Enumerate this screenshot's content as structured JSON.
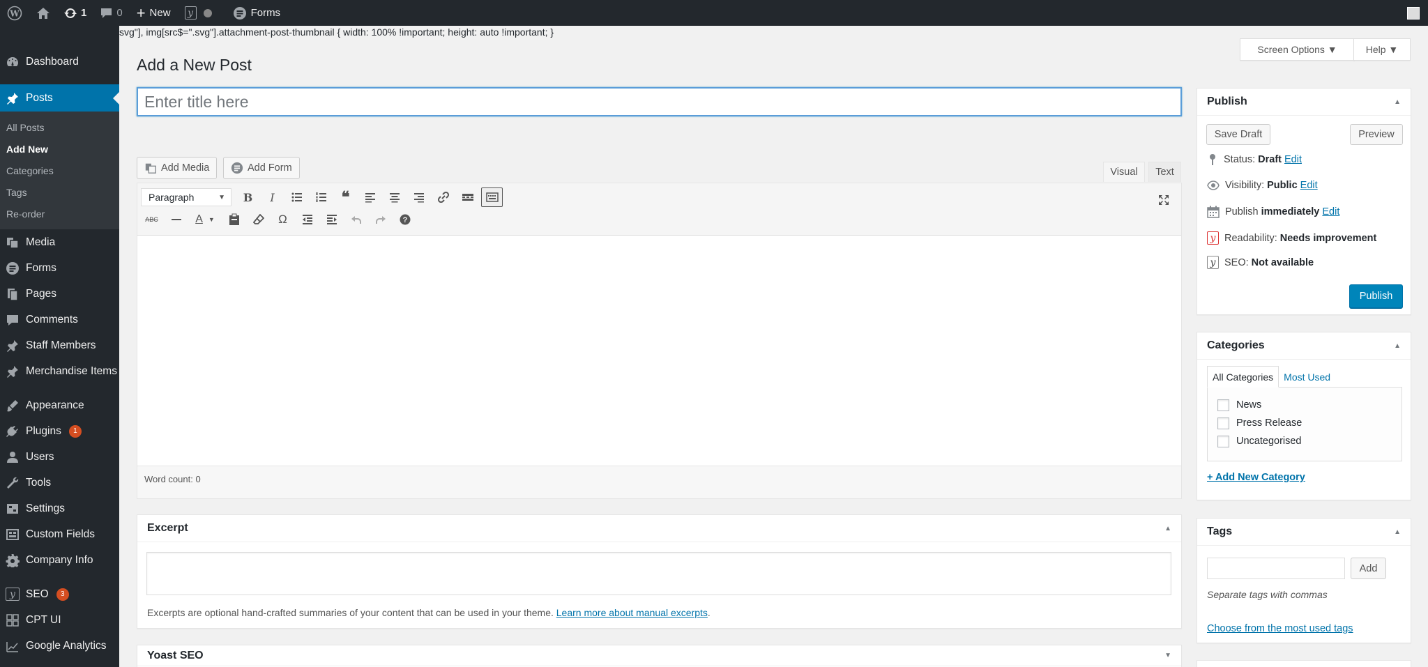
{
  "adminbar": {
    "updates_count": "1",
    "comments_count": "0",
    "new_label": "New",
    "forms_label": "Forms"
  },
  "sidebar": {
    "items_top": [
      {
        "label": "Dashboard",
        "icon": "dashboard-icon"
      }
    ],
    "posts": {
      "label": "Posts",
      "icon": "pushpin-icon",
      "submenu": [
        "All Posts",
        "Add New",
        "Categories",
        "Tags",
        "Re-order"
      ]
    },
    "items": [
      {
        "label": "Media",
        "icon": "media-icon"
      },
      {
        "label": "Forms",
        "icon": "forms-icon"
      },
      {
        "label": "Pages",
        "icon": "pages-icon"
      },
      {
        "label": "Comments",
        "icon": "comments-icon"
      },
      {
        "label": "Staff Members",
        "icon": "pushpin-icon"
      },
      {
        "label": "Merchandise Items",
        "icon": "pushpin-icon"
      },
      {
        "label": "Appearance",
        "icon": "appearance-icon"
      },
      {
        "label": "Plugins",
        "icon": "plugins-icon",
        "badge": "1"
      },
      {
        "label": "Users",
        "icon": "users-icon"
      },
      {
        "label": "Tools",
        "icon": "tools-icon"
      },
      {
        "label": "Settings",
        "icon": "settings-icon"
      },
      {
        "label": "Custom Fields",
        "icon": "custom-fields-icon"
      },
      {
        "label": "Company Info",
        "icon": "gear-icon"
      },
      {
        "label": "SEO",
        "icon": "yoast-icon",
        "badge": "3"
      },
      {
        "label": "CPT UI",
        "icon": "cpt-ui-icon"
      },
      {
        "label": "Google Analytics",
        "icon": "analytics-icon"
      }
    ]
  },
  "css_leak": "svg\"], img[src$=\".svg\"].attachment-post-thumbnail { width: 100% !important; height: auto !important; }",
  "screen_options": "Screen Options ▼",
  "help": "Help ▼",
  "page_title": "Add a New Post",
  "title_placeholder": "Enter title here",
  "editor": {
    "add_media": "Add Media",
    "add_form": "Add Form",
    "tab_visual": "Visual",
    "tab_text": "Text",
    "format": "Paragraph",
    "word_count": "Word count: 0"
  },
  "excerpt": {
    "title": "Excerpt",
    "help_text": "Excerpts are optional hand-crafted summaries of your content that can be used in your theme.",
    "help_link": "Learn more about manual excerpts",
    "help_end": "."
  },
  "yoast": {
    "title": "Yoast SEO"
  },
  "publish": {
    "title": "Publish",
    "save_draft": "Save Draft",
    "preview": "Preview",
    "status_label": "Status:",
    "status_value": "Draft",
    "visibility_label": "Visibility:",
    "visibility_value": "Public",
    "schedule_label": "Publish",
    "schedule_value": "immediately",
    "edit": "Edit",
    "readability_label": "Readability:",
    "readability_value": "Needs improvement",
    "seo_label": "SEO:",
    "seo_value": "Not available",
    "publish_button": "Publish"
  },
  "categories": {
    "title": "Categories",
    "tab_all": "All Categories",
    "tab_most_used": "Most Used",
    "items": [
      "News",
      "Press Release",
      "Uncategorised"
    ],
    "add_new": "+ Add New Category"
  },
  "tags": {
    "title": "Tags",
    "add": "Add",
    "help": "Separate tags with commas",
    "choose": "Choose from the most used tags"
  },
  "colors": {
    "admin_dark": "#23282d",
    "accent_blue": "#0073aa",
    "publish_blue": "#0085ba",
    "badge_orange": "#d54e21"
  }
}
